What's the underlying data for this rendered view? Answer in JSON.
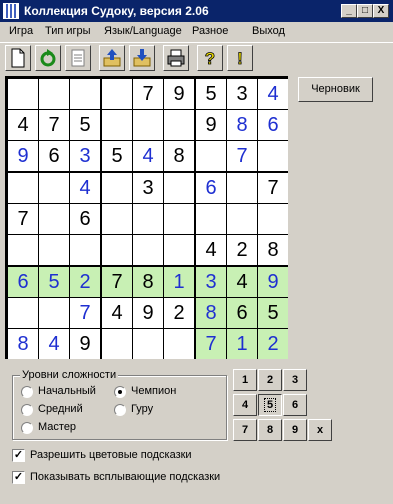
{
  "window": {
    "title": "Коллекция Судоку, версия 2.06",
    "controls": [
      "_",
      "□",
      "X"
    ]
  },
  "menu": [
    "Игра",
    "Тип игры",
    "Язык/Language",
    "Разное",
    "Выход"
  ],
  "toolbar": [
    "new-document-icon",
    "restart-icon",
    "clipboard-icon",
    "open-up-icon",
    "save-down-icon",
    "print-icon",
    "help-question-icon",
    "hint-exclamation-icon"
  ],
  "board": {
    "cells": [
      [
        "",
        "",
        "",
        "",
        "7",
        "9",
        "5",
        "3",
        "4"
      ],
      [
        "4",
        "7",
        "5",
        "",
        "",
        "",
        "9",
        "8",
        "6"
      ],
      [
        "9",
        "6",
        "3",
        "5",
        "4",
        "8",
        "",
        "7",
        ""
      ],
      [
        "",
        "",
        "4",
        "",
        "3",
        "",
        "6",
        "",
        "7"
      ],
      [
        "7",
        "",
        "6",
        "",
        "",
        "",
        "",
        "",
        ""
      ],
      [
        "",
        "",
        "",
        "",
        "",
        "",
        "4",
        "2",
        "8"
      ],
      [
        "6",
        "5",
        "2",
        "7",
        "8",
        "1",
        "3",
        "4",
        "9"
      ],
      [
        "",
        "",
        "7",
        "4",
        "9",
        "2",
        "8",
        "6",
        "5"
      ],
      [
        "8",
        "4",
        "9",
        "",
        "",
        "",
        "7",
        "1",
        "2"
      ]
    ],
    "user_entered": [
      [
        0,
        0,
        0,
        0,
        0,
        0,
        0,
        0,
        1
      ],
      [
        0,
        0,
        0,
        0,
        0,
        0,
        0,
        1,
        1
      ],
      [
        1,
        0,
        1,
        0,
        1,
        0,
        0,
        1,
        0
      ],
      [
        0,
        0,
        1,
        0,
        0,
        0,
        1,
        0,
        0
      ],
      [
        0,
        0,
        0,
        0,
        0,
        0,
        0,
        0,
        0
      ],
      [
        0,
        0,
        0,
        0,
        0,
        0,
        0,
        0,
        0
      ],
      [
        1,
        1,
        1,
        0,
        0,
        1,
        1,
        0,
        1
      ],
      [
        0,
        0,
        1,
        0,
        0,
        0,
        1,
        0,
        0
      ],
      [
        1,
        1,
        0,
        0,
        0,
        0,
        1,
        1,
        1
      ]
    ],
    "highlight_row": 6,
    "highlight_box": [
      2,
      2
    ],
    "highlight_color": "#c8f0b4",
    "user_color": "#1e2fd1"
  },
  "draft_button": "Черновик",
  "difficulty": {
    "label": "Уровни сложности",
    "options": [
      "Начальный",
      "Средний",
      "Мастер",
      "Чемпион",
      "Гуру"
    ],
    "selected": "Чемпион"
  },
  "numpad": {
    "keys": [
      "1",
      "2",
      "3",
      "4",
      "5",
      "6",
      "7",
      "8",
      "9",
      "x"
    ],
    "pressed": "5"
  },
  "checkboxes": [
    {
      "label": "Разрешить цветовые подсказки",
      "checked": true
    },
    {
      "label": "Показывать всплывающие подсказки",
      "checked": true
    }
  ]
}
